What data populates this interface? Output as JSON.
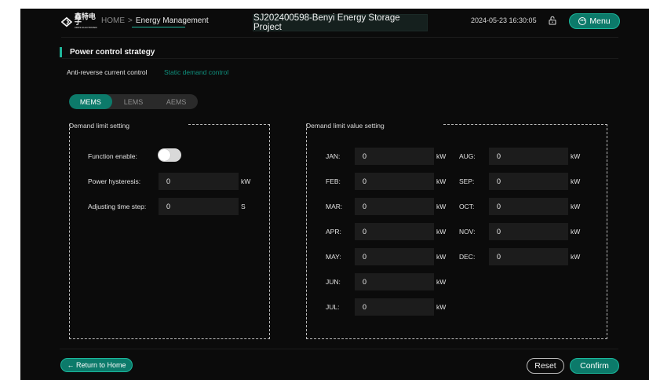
{
  "header": {
    "logo_text": "鑫特电子",
    "logo_sub": "XINTE ELECTRONIC",
    "home": "HOME",
    "breadcrumb_sep": ">",
    "current_page": "Energy Management",
    "project": "SJ202400598-Benyi Energy Storage Project",
    "datetime": "2024-05-23 16:30:05",
    "menu_label": "Menu",
    "menu_icon": "menu-circle-icon",
    "lock_icon": "unlock-icon"
  },
  "section": {
    "title": "Power control strategy",
    "subtabs": [
      "Anti-reverse current control",
      "Static demand control"
    ],
    "active_subtab": "Anti-reverse current control"
  },
  "modes": {
    "items": [
      "MEMS",
      "LEMS",
      "AEMS"
    ],
    "active": "MEMS"
  },
  "demand_limit": {
    "title": "Demand limit setting",
    "function_enable_label": "Function enable:",
    "function_enable_on": false,
    "power_hysteresis_label": "Power hysteresis:",
    "power_hysteresis_value": "0",
    "power_hysteresis_unit": "kW",
    "adjusting_time_step_label": "Adjusting time step:",
    "adjusting_time_step_value": "0",
    "adjusting_time_step_unit": "S"
  },
  "demand_value": {
    "title": "Demand limit value setting",
    "unit": "kW",
    "months": [
      {
        "label": "JAN:",
        "value": "0"
      },
      {
        "label": "FEB:",
        "value": "0"
      },
      {
        "label": "MAR:",
        "value": "0"
      },
      {
        "label": "APR:",
        "value": "0"
      },
      {
        "label": "MAY:",
        "value": "0"
      },
      {
        "label": "JUN:",
        "value": "0"
      },
      {
        "label": "JUL:",
        "value": "0"
      },
      {
        "label": "AUG:",
        "value": "0"
      },
      {
        "label": "SEP:",
        "value": "0"
      },
      {
        "label": "OCT:",
        "value": "0"
      },
      {
        "label": "NOV:",
        "value": "0"
      },
      {
        "label": "DEC:",
        "value": "0"
      }
    ]
  },
  "footer": {
    "return_label": "← Return to Home",
    "reset_label": "Reset",
    "confirm_label": "Confirm"
  },
  "colors": {
    "accent": "#0c7a6a",
    "accent_border": "#1ab89c",
    "background": "#0b0b0b",
    "input_bg": "#1c1c1c"
  }
}
